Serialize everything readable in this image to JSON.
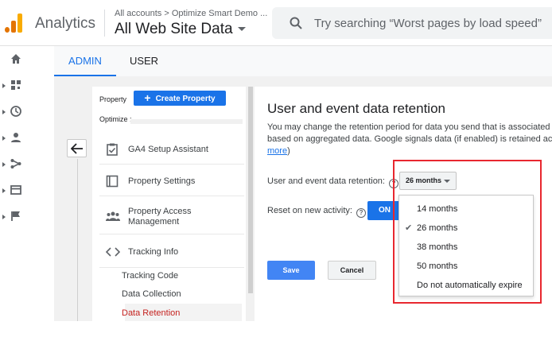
{
  "header": {
    "app_name": "Analytics",
    "breadcrumb": "All accounts > Optimize Smart Demo ...",
    "account_view": "All Web Site Data",
    "search_placeholder": "Try searching “Worst pages by load speed”"
  },
  "logo_colors": [
    "#f9ab00",
    "#e37400",
    "#e37400"
  ],
  "rail": {
    "items": [
      {
        "icon": "home-icon",
        "expandable": false
      },
      {
        "icon": "customization-icon",
        "expandable": true
      },
      {
        "icon": "realtime-clock-icon",
        "expandable": true
      },
      {
        "icon": "audience-person-icon",
        "expandable": true
      },
      {
        "icon": "acquisition-icon",
        "expandable": true
      },
      {
        "icon": "behavior-icon",
        "expandable": true
      },
      {
        "icon": "conversions-flag-icon",
        "expandable": true
      }
    ]
  },
  "tabs": [
    {
      "label": "ADMIN",
      "active": true
    },
    {
      "label": "USER",
      "active": false
    }
  ],
  "nav": {
    "property_label": "Property",
    "create_property": "Create Property",
    "optimize_label": "Optimize :",
    "items": [
      {
        "label": "GA4 Setup Assistant",
        "icon": "checklist-icon"
      },
      {
        "label": "Property Settings",
        "icon": "settings-square-icon"
      },
      {
        "label_line1": "Property Access",
        "label_line2": "Management",
        "icon": "people-icon"
      },
      {
        "label": "Tracking Info",
        "icon": "code-icon"
      }
    ],
    "sub_items": [
      {
        "label": "Tracking Code",
        "active": false
      },
      {
        "label": "Data Collection",
        "active": false
      },
      {
        "label": "Data Retention",
        "active": true
      }
    ]
  },
  "main": {
    "title": "User and event data retention",
    "desc_line1": "You may change the retention period for data you send that is associated",
    "desc_line2": "based on aggregated data. Google signals data (if enabled) is retained acc",
    "desc_link": "more",
    "desc_link_suffix": ")",
    "retention_label": "User and event data retention:",
    "retention_value": "26 months",
    "reset_label": "Reset on new activity:",
    "reset_toggle": "ON",
    "save": "Save",
    "cancel": "Cancel"
  },
  "dropdown": {
    "options": [
      {
        "label": "14 months",
        "selected": false
      },
      {
        "label": "26 months",
        "selected": true
      },
      {
        "label": "38 months",
        "selected": false
      },
      {
        "label": "50 months",
        "selected": false
      },
      {
        "label": "Do not automatically expire",
        "selected": false
      }
    ]
  },
  "colors": {
    "accent": "#1a73e8",
    "highlight": "#e8272f",
    "active_link": "#c5221f"
  }
}
